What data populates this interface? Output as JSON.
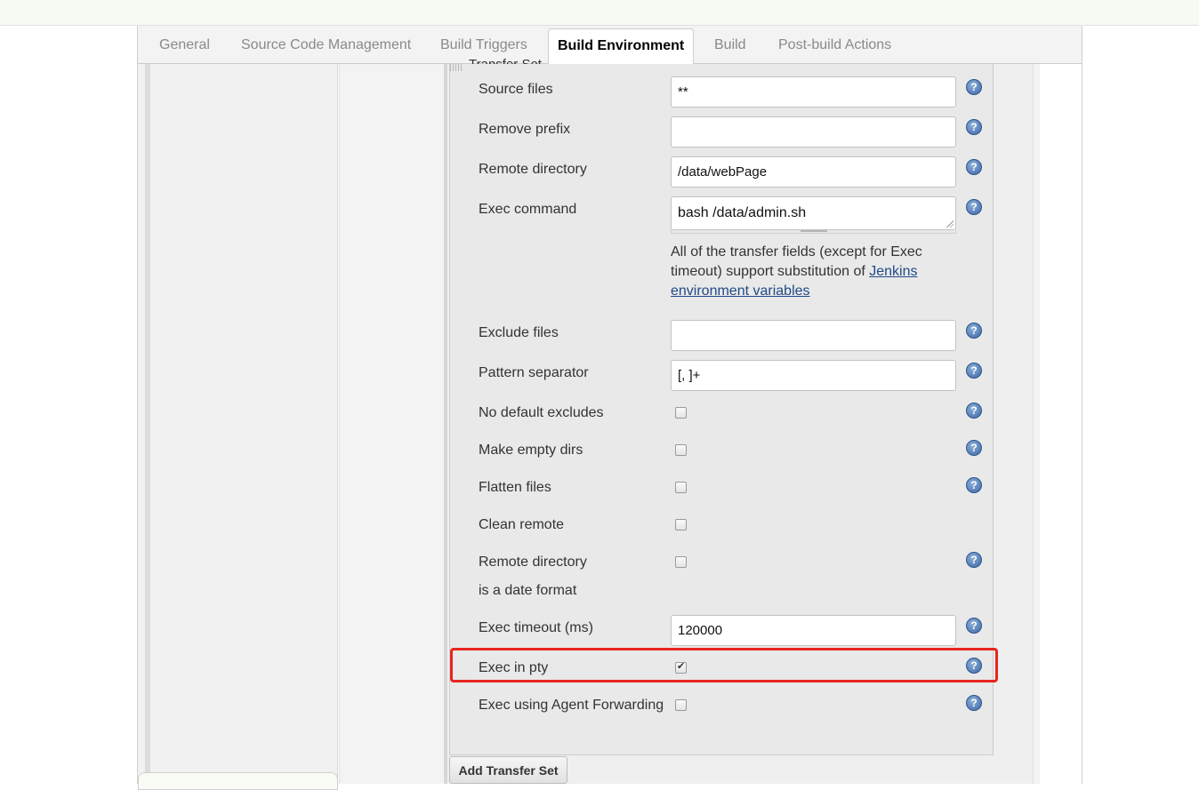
{
  "tabs": [
    {
      "label": "General"
    },
    {
      "label": "Source Code Management"
    },
    {
      "label": "Build Triggers"
    },
    {
      "label": "Build Environment"
    },
    {
      "label": "Build"
    },
    {
      "label": "Post-build Actions"
    }
  ],
  "transfer_set": {
    "partial_title": "Transfer Set",
    "source_files": {
      "label": "Source files",
      "value": "**"
    },
    "remove_prefix": {
      "label": "Remove prefix",
      "value": ""
    },
    "remote_directory": {
      "label": "Remote directory",
      "value": "/data/webPage"
    },
    "exec_command": {
      "label": "Exec command",
      "value": "bash /data/admin.sh"
    },
    "help_text_prefix": "All of the transfer fields (except for Exec timeout) support substitution of ",
    "help_text_link": "Jenkins environment variables",
    "exclude_files": {
      "label": "Exclude files",
      "value": ""
    },
    "pattern_separator": {
      "label": "Pattern separator",
      "value": "[, ]+"
    },
    "no_default_excludes": {
      "label": "No default excludes",
      "checked": false
    },
    "make_empty_dirs": {
      "label": "Make empty dirs",
      "checked": false
    },
    "flatten_files": {
      "label": "Flatten files",
      "checked": false
    },
    "clean_remote": {
      "label": "Clean remote",
      "checked": false
    },
    "remote_directory_date": {
      "label_line1": "Remote directory",
      "label_line2": "is a date format",
      "checked": false
    },
    "exec_timeout": {
      "label": "Exec timeout (ms)",
      "value": "120000"
    },
    "exec_in_pty": {
      "label": "Exec in pty",
      "checked": true
    },
    "exec_agent_forwarding": {
      "label": "Exec using Agent Forwarding",
      "checked": false
    }
  },
  "help_icon_glyph": "?",
  "add_transfer_set_label": "Add Transfer Set",
  "colors": {
    "highlight": "#e8251e",
    "link": "#204a87",
    "help_icon": "#3b67a6"
  }
}
